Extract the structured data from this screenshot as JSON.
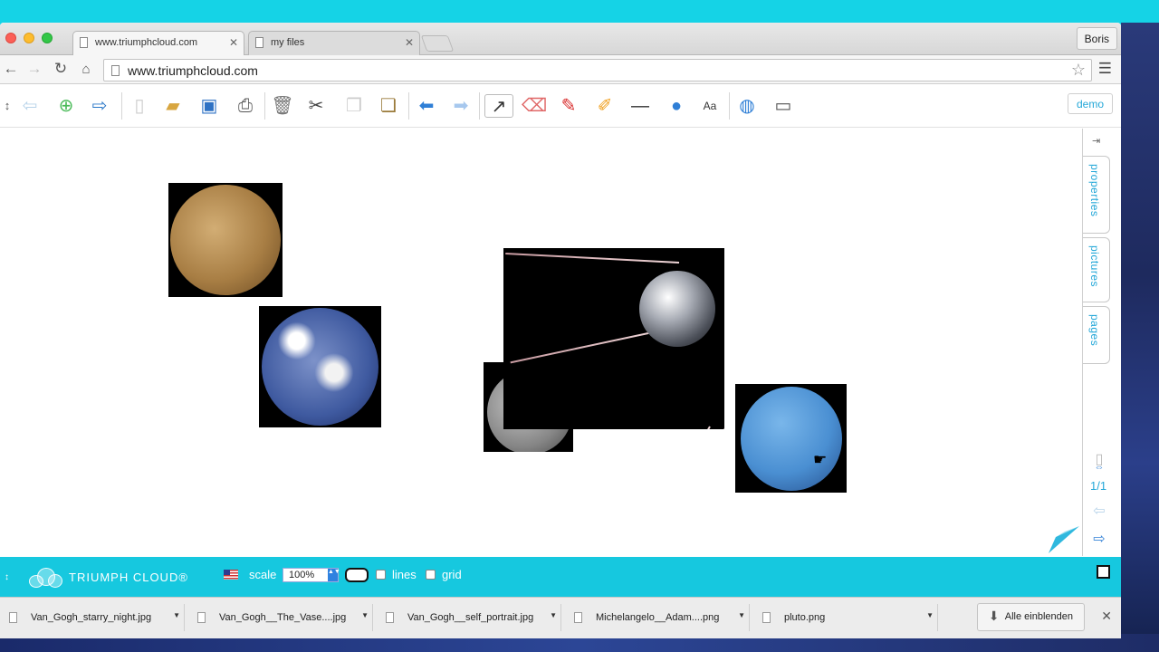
{
  "browser": {
    "tabs": [
      {
        "label": "www.triumphcloud.com",
        "active": true
      },
      {
        "label": "my files",
        "active": false
      }
    ],
    "profile": "Boris",
    "url": "www.triumphcloud.com"
  },
  "app": {
    "demo_label": "demo",
    "side_tabs": [
      "properties",
      "pictures",
      "pages"
    ],
    "page_counter": "1/1",
    "canvas_images": [
      {
        "name": "mercury"
      },
      {
        "name": "earth"
      },
      {
        "name": "moon"
      },
      {
        "name": "sputnik"
      },
      {
        "name": "neptune"
      }
    ]
  },
  "statusbar": {
    "brand": "TRIUMPH CLOUD®",
    "scale_label": "scale",
    "scale_value": "100%",
    "lines_label": "lines",
    "grid_label": "grid"
  },
  "downloads": {
    "items": [
      "Van_Gogh_starry_night.jpg",
      "Van_Gogh__The_Vase....jpg",
      "Van_Gogh__self_portrait.jpg",
      "Michelangelo__Adam....png",
      "pluto.png"
    ],
    "show_all": "Alle einblenden"
  },
  "colors": {
    "accent": "#23a7d8",
    "statusbar": "#16c8df"
  }
}
